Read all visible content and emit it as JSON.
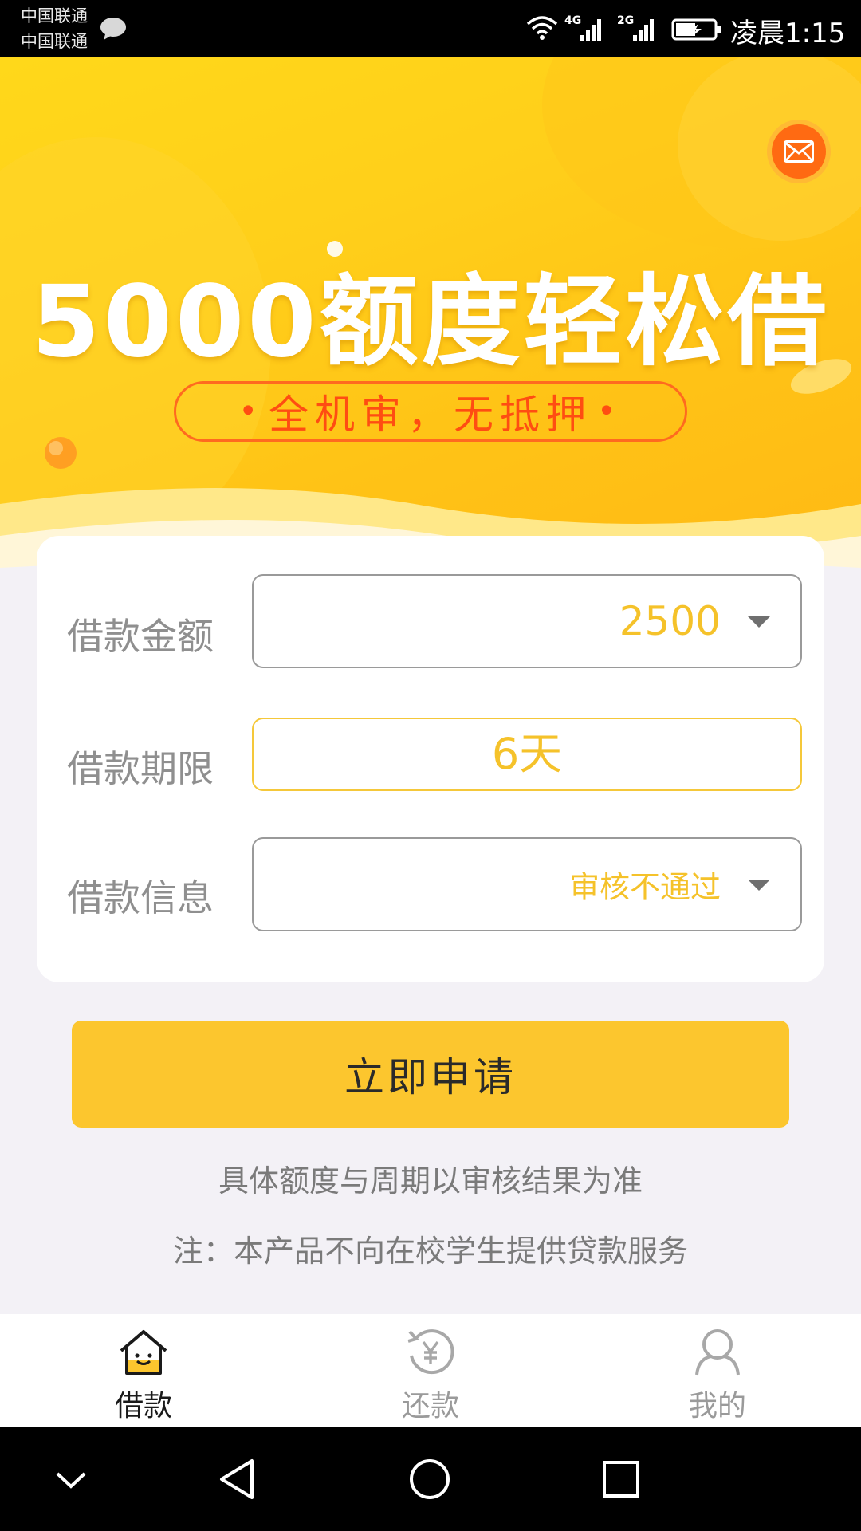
{
  "status_bar": {
    "carrier_1": "中国联通",
    "carrier_2": "中国联通",
    "network_1": "4G",
    "network_2": "2G",
    "time": "凌晨1:15",
    "icons": [
      "chat-icon",
      "wifi-icon",
      "signal-icon",
      "signal-icon",
      "battery-charging-icon"
    ]
  },
  "banner": {
    "headline": "5000额度轻松借",
    "tagline": "全机审，无抵押",
    "bullet": "•",
    "icon": "mail-icon",
    "colors": {
      "primary": "#ffcf1a",
      "accent": "#ff6a12",
      "tagline": "#ff4d12"
    }
  },
  "form": {
    "amount": {
      "label": "借款金额",
      "value": "2500"
    },
    "term": {
      "label": "借款期限",
      "value": "6天"
    },
    "info": {
      "label": "借款信息",
      "value": "审核不通过"
    },
    "value_color": "#f5c22a"
  },
  "apply": {
    "label": "立即申请",
    "color": "#fcc62e"
  },
  "notes": {
    "line_1": "具体额度与周期以审核结果为准",
    "line_2": "注：本产品不向在校学生提供贷款服务"
  },
  "tabs": [
    {
      "label": "借款",
      "icon": "house-icon",
      "active": true
    },
    {
      "label": "还款",
      "icon": "yuan-refresh-icon",
      "active": false
    },
    {
      "label": "我的",
      "icon": "user-icon",
      "active": false
    }
  ],
  "navbar": {
    "icons": [
      "chevron-down-icon",
      "back-triangle-icon",
      "home-circle-icon",
      "recent-square-icon"
    ]
  }
}
